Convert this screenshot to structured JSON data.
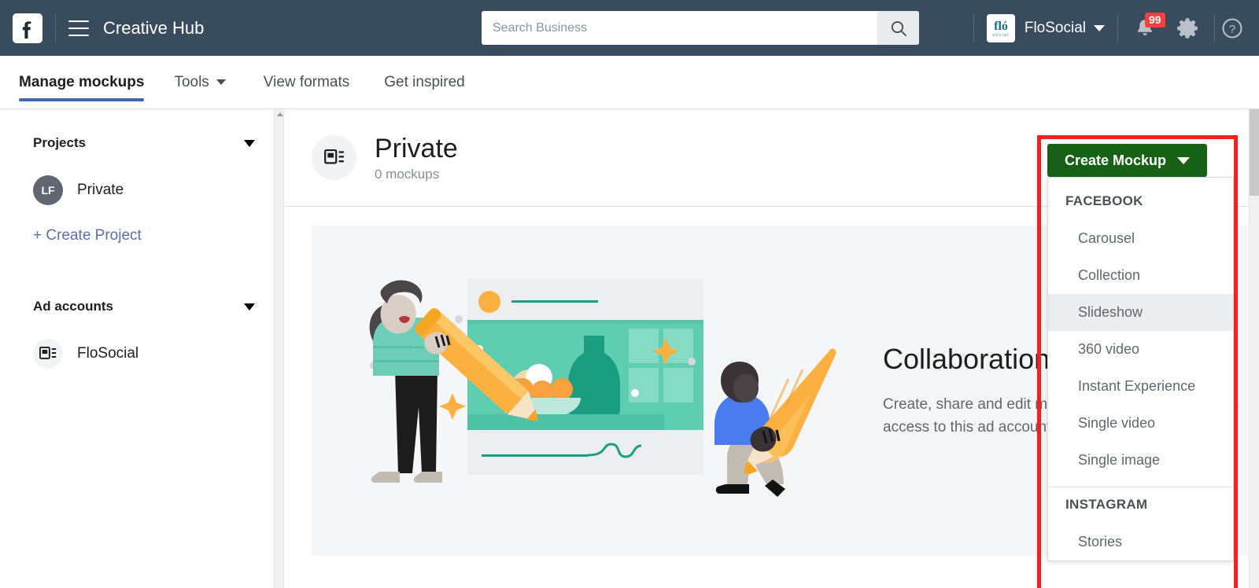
{
  "topbar": {
    "logo_icon": "facebook-logo-icon",
    "menu_icon": "hamburger-menu-icon",
    "app_title": "Creative Hub",
    "search": {
      "placeholder": "Search Business",
      "value": "",
      "icon": "search-icon"
    },
    "business": {
      "name": "FloSocial",
      "logo_text": "fló",
      "logo_sub": "social",
      "caret": "chevron-down-icon"
    },
    "notifications": {
      "icon": "bell-icon",
      "count": "99"
    },
    "settings_icon": "gear-icon",
    "help_icon": "question-mark-icon"
  },
  "nav": {
    "tabs": [
      {
        "label": "Manage mockups",
        "active": true,
        "has_caret": false
      },
      {
        "label": "Tools",
        "active": false,
        "has_caret": true
      },
      {
        "label": "View formats",
        "active": false,
        "has_caret": false
      },
      {
        "label": "Get inspired",
        "active": false,
        "has_caret": false
      }
    ],
    "active_underline_color": "#4267b2"
  },
  "sidebar": {
    "projects": {
      "title": "Projects",
      "caret": "caret-down-icon",
      "items": [
        {
          "initials": "LF",
          "label": "Private"
        }
      ],
      "create_label": "+ Create Project"
    },
    "ad_accounts": {
      "title": "Ad accounts",
      "caret": "caret-down-icon",
      "items": [
        {
          "icon": "ad-account-icon",
          "label": "FloSocial"
        }
      ]
    }
  },
  "content": {
    "project_icon": "ad-account-icon",
    "title": "Private",
    "subtitle": "0 mockups",
    "hero": {
      "heading": "Collaboration happens here",
      "body": "Create, share and edit mockups with anyone who has access to this ad account inside Creative Hub.",
      "illustration": "collaboration-illustration"
    }
  },
  "create_mockup": {
    "button_label": "Create Mockup",
    "button_caret": "chevron-down-icon",
    "button_color": "#176116",
    "highlight_color": "#f42121",
    "menu": [
      {
        "group": "FACEBOOK",
        "items": [
          {
            "label": "Carousel",
            "hovered": false
          },
          {
            "label": "Collection",
            "hovered": false
          },
          {
            "label": "Slideshow",
            "hovered": true
          },
          {
            "label": "360 video",
            "hovered": false
          },
          {
            "label": "Instant Experience",
            "hovered": false
          },
          {
            "label": "Single video",
            "hovered": false
          },
          {
            "label": "Single image",
            "hovered": false
          }
        ]
      },
      {
        "group": "INSTAGRAM",
        "items": [
          {
            "label": "Stories",
            "hovered": false
          }
        ]
      }
    ]
  }
}
